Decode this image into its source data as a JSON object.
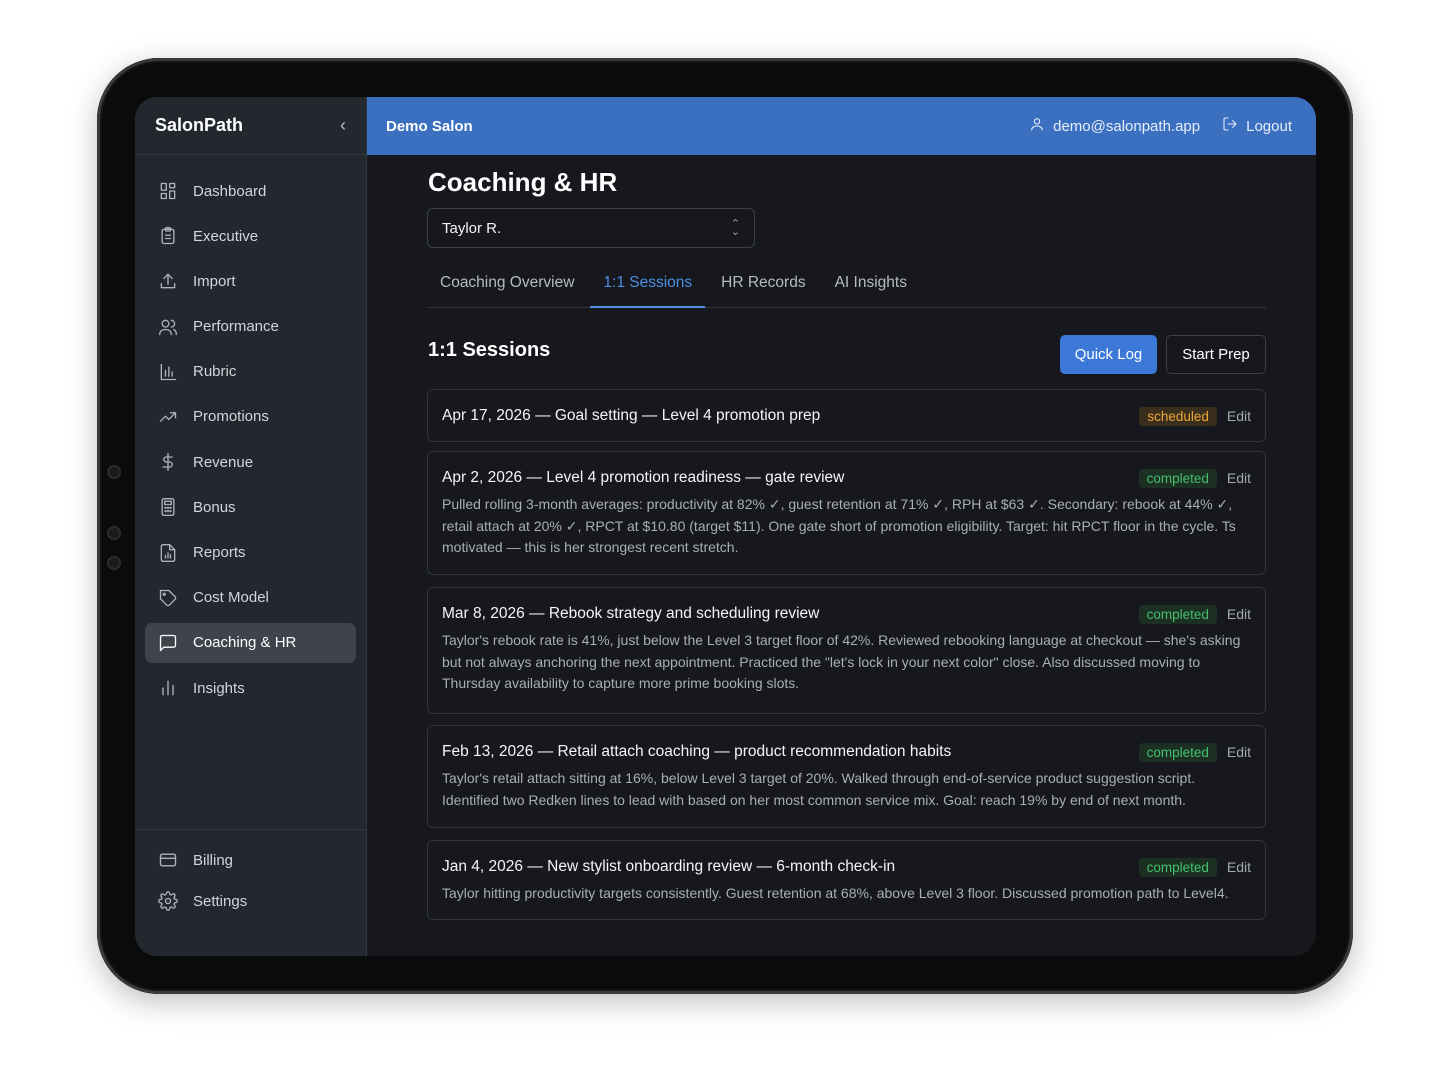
{
  "app": {
    "brand": "SalonPath",
    "org": "Demo Salon",
    "user_email": "demo@salonpath.app",
    "logout_label": "Logout"
  },
  "sidebar": {
    "items": [
      {
        "label": "Dashboard",
        "icon": "grid-icon"
      },
      {
        "label": "Executive",
        "icon": "clipboard-icon"
      },
      {
        "label": "Import",
        "icon": "upload-icon"
      },
      {
        "label": "Performance",
        "icon": "users-icon"
      },
      {
        "label": "Rubric",
        "icon": "bar-chart-icon"
      },
      {
        "label": "Promotions",
        "icon": "trending-up-icon"
      },
      {
        "label": "Revenue",
        "icon": "dollar-icon"
      },
      {
        "label": "Bonus",
        "icon": "calculator-icon"
      },
      {
        "label": "Reports",
        "icon": "file-chart-icon"
      },
      {
        "label": "Cost Model",
        "icon": "tag-icon"
      },
      {
        "label": "Coaching & HR",
        "icon": "message-square-icon",
        "active": true
      },
      {
        "label": "Insights",
        "icon": "chart-line-icon"
      }
    ],
    "bottom_items": [
      {
        "label": "Billing",
        "icon": "credit-card-icon"
      },
      {
        "label": "Settings",
        "icon": "gear-icon"
      }
    ]
  },
  "main": {
    "title": "Coaching & HR",
    "stylist_select": {
      "selected": "Taylor R."
    },
    "tabs": [
      {
        "label": "Coaching Overview"
      },
      {
        "label": "1:1 Sessions",
        "active": true
      },
      {
        "label": "HR Records"
      },
      {
        "label": "AI Insights"
      }
    ],
    "section_title": "1:1 Sessions",
    "quick_log_label": "Quick Log",
    "start_prep_label": "Start Prep",
    "edit_label": "Edit",
    "sessions": [
      {
        "title": "Apr 17, 2026 — Goal setting — Level 4 promotion prep",
        "status": "scheduled",
        "notes": ""
      },
      {
        "title": "Apr 2, 2026 — Level 4 promotion readiness — gate review",
        "status": "completed",
        "notes": "Pulled rolling 3-month averages: productivity at 82% ✓, guest retention at 71% ✓, RPH at $63 ✓. Secondary: rebook at 44% ✓, retail attach at 20% ✓, RPCT at $10.80 (target $11). One gate short of promotion eligibility. Target: hit RPCT floor in the cycle. Ts motivated — this is her strongest recent stretch."
      },
      {
        "title": "Mar 8, 2026 — Rebook strategy and scheduling review",
        "status": "completed",
        "notes": "Taylor's rebook rate is 41%, just below the Level 3 target floor of 42%. Reviewed rebooking language at checkout — she's asking but not always anchoring the next appointment. Practiced the \"let's lock in your next color\" close. Also discussed moving to Thursday availability to capture more prime booking slots."
      },
      {
        "title": "Feb 13, 2026 — Retail attach coaching — product recommendation habits",
        "status": "completed",
        "notes": "Taylor's retail attach sitting at 16%, below Level 3 target of 20%. Walked through end-of-service product suggestion script. Identified two Redken lines to lead with based on her most common service mix. Goal: reach 19% by end of next month."
      },
      {
        "title": "Jan 4, 2026 — New stylist onboarding review — 6-month check-in",
        "status": "completed",
        "notes": "Taylor hitting productivity targets consistently. Guest retention at 68%, above Level 3 floor. Discussed promotion path to Level4."
      }
    ]
  },
  "colors": {
    "header": "#3b6fbf",
    "accent": "#4f8ee3",
    "primary_button": "#3b78d8",
    "scheduled": "#f0a636",
    "completed": "#45c16d"
  }
}
